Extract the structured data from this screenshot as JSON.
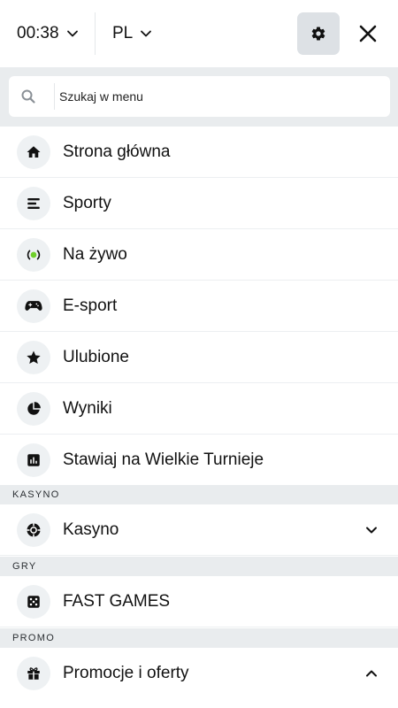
{
  "topbar": {
    "time": "00:38",
    "language": "PL"
  },
  "search": {
    "placeholder": "Szukaj w menu"
  },
  "menu": {
    "home": "Strona główna",
    "sports": "Sporty",
    "live": "Na żywo",
    "esport": "E-sport",
    "favorites": "Ulubione",
    "results": "Wyniki",
    "tournaments": "Stawiaj na Wielkie Turnieje"
  },
  "sections": {
    "casino_header": "KASYNO",
    "casino_item": "Kasyno",
    "games_header": "GRY",
    "games_item": "FAST GAMES",
    "promo_header": "PROMO",
    "promo_item": "Promocje i oferty"
  },
  "icons": {
    "time_dropdown": "chevron-down-icon",
    "lang_dropdown": "chevron-down-icon",
    "settings": "gear-icon",
    "close": "close-icon",
    "search": "search-icon",
    "home": "home-icon",
    "sports": "sports-list-icon",
    "live": "live-broadcast-icon",
    "esport": "gamepad-icon",
    "favorites": "star-icon",
    "results": "pie-chart-icon",
    "tournaments": "bar-chart-icon",
    "casino": "poker-chip-icon",
    "fast_games": "dice-icon",
    "promo": "gift-icon"
  },
  "colors": {
    "live_accent": "#6fcf2a",
    "settings_bg": "#dde1e5",
    "section_bg": "#e9ecee",
    "icon_circle_bg": "#eef1f3"
  }
}
